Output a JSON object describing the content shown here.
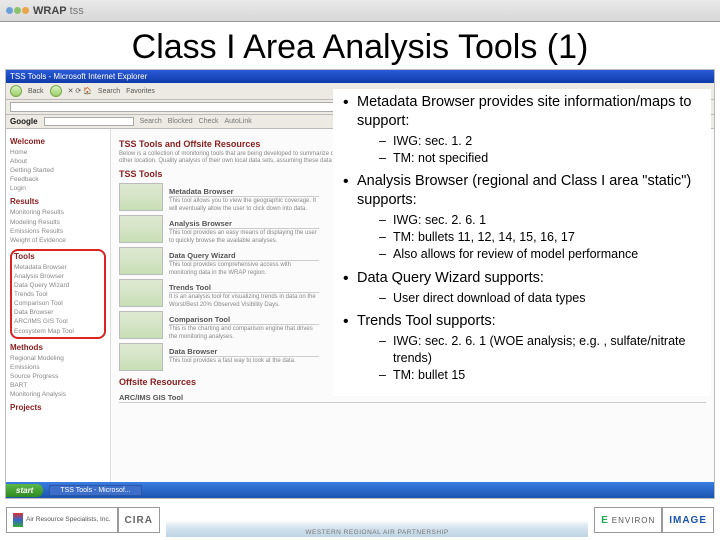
{
  "topbar": {
    "brand": "WRAP",
    "product": "tss"
  },
  "title": "Class I Area Analysis Tools (1)",
  "browser": {
    "window_title": "TSS Tools - Microsoft Internet Explorer",
    "toolbar": {
      "back": "Back",
      "search": "Search",
      "favorites": "Favorites"
    },
    "google_label": "Google",
    "google_items": [
      "Search",
      "Blocked",
      "Check",
      "AutoLink"
    ],
    "sidebar": {
      "welcome": "Welcome",
      "welcome_items": [
        "Home",
        "About",
        "Getting Started",
        "Feedback",
        "Login"
      ],
      "results": "Results",
      "results_items": [
        "Monitoring Results",
        "Modeling Results",
        "Emissions Results",
        "Weight of Evidence"
      ],
      "tools": "Tools",
      "tools_items": [
        "Metadata Browser",
        "Analysis Browser",
        "Data Query Wizard",
        "Trends Tool",
        "Comparison Tool",
        "Data Browser",
        "ARC/IMS GIS Tool",
        "Ecosystem Map Tool"
      ],
      "methods": "Methods",
      "methods_items": [
        "Regional Modeling",
        "Emissions",
        "Source Progress",
        "BART",
        "Monitoring Analysis"
      ],
      "projects": "Projects"
    },
    "main": {
      "heading": "TSS Tools and Offsite Resources",
      "blurb": "Below is a collection of monitoring tools that are being developed to summarize data in graphical, or analytical fashion. Tools are being extended to provide access to both monitoring and emissions data in one place or one other location. Quality analysis of their own local data sets, assuming these data sets are integrated software system that is used to analyze and summarize.",
      "section": "TSS Tools",
      "items": [
        {
          "name": "Metadata Browser",
          "desc": "This tool allows you to view the geographic coverage. It will eventually allow the user to click down into data."
        },
        {
          "name": "Analysis Browser",
          "desc": "This tool provides an easy means of displaying the user to quickly browse the available analyses."
        },
        {
          "name": "Data Query Wizard",
          "desc": "This tool provides comprehensive access with monitoring data in the WRAP region."
        },
        {
          "name": "Trends Tool",
          "desc": "It is an analysis tool for visualizing trends in data on the Worst/Best 20% Observed Visibility Days."
        },
        {
          "name": "Comparison Tool",
          "desc": "This is the charting and comparison engine that drives the monitoring analyses."
        },
        {
          "name": "Data Browser",
          "desc": "This tool provides a fast way to look at the data."
        }
      ],
      "offsite": "Offsite Resources",
      "offsite_item": "ARC/IMS GIS Tool"
    },
    "taskbar": {
      "start": "start",
      "task": "TSS Tools - Microsof..."
    }
  },
  "overlay": {
    "b1": "Metadata Browser provides site information/maps to support:",
    "b1_sub": [
      "IWG: sec. 1. 2",
      "TM: not specified"
    ],
    "b2": "Analysis Browser (regional and Class I area \"static\") supports:",
    "b2_sub": [
      "IWG: sec. 2. 6. 1",
      "TM: bullets 11, 12, 14, 15, 16, 17",
      "Also allows for review of model performance"
    ],
    "b3": "Data Query Wizard supports:",
    "b3_sub": [
      "User direct download of data types"
    ],
    "b4": "Trends Tool supports:",
    "b4_sub": [
      "IWG: sec. 2. 6. 1 (WOE analysis; e.g. , sulfate/nitrate trends)",
      "TM: bullet 15"
    ]
  },
  "footer": {
    "ars": "Air Resource Specialists, Inc.",
    "cira": "CIRA",
    "wrap": "WESTERN REGIONAL AIR PARTNERSHIP",
    "environ": "ENVIRON",
    "image": "IMAGE"
  }
}
